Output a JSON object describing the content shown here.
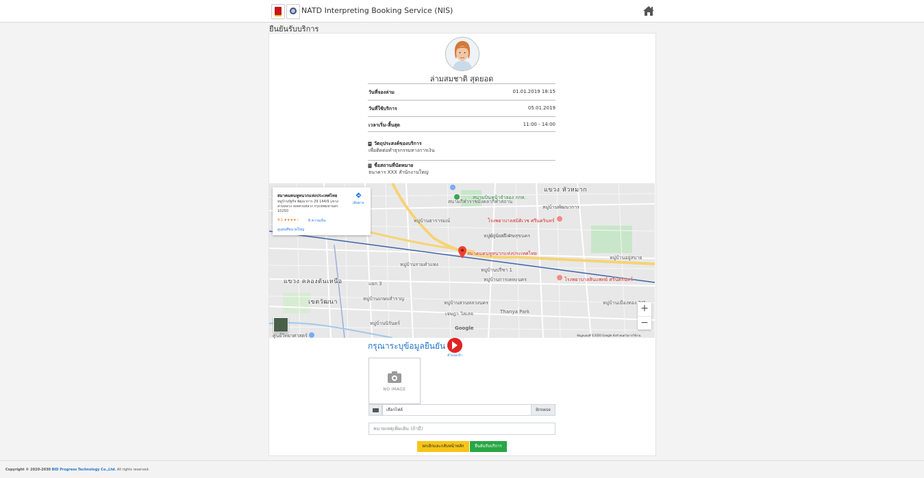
{
  "header": {
    "app_title": "NATD Interpreting Booking Service (NIS)"
  },
  "page": {
    "heading": "ยืนยันรับบริการ"
  },
  "profile": {
    "name": "ล่ามสมชาติ สุดยอด"
  },
  "details": [
    {
      "label": "วันที่จองล่าม",
      "value": "01.01.2019 18:15"
    },
    {
      "label": "วันที่ใช้บริการ",
      "value": "05.01.2019"
    },
    {
      "label": "เวลาเริ่ม-สิ้นสุด",
      "value": "11:00 - 14:00"
    }
  ],
  "purpose": {
    "title": "วัตถุประสงค์ของบริการ",
    "value": "เพื่อติดต่อทำธุรกรรมทางการเงิน"
  },
  "location": {
    "title": "ชื่อสถานที่นัดหมาย",
    "value": "ธนาคาร XXX สำนักงานใหญ่"
  },
  "map": {
    "place_name": "สมาคมคนหูหนวกแห่งประเทศไทย",
    "place_address": "หมู่บ้านรัฐกิจ พัฒนาการ 29 144/9 แขวงสวนหลวง เขตสวนหลวง กรุงเทพมหานคร 10250",
    "rating": "4.1 ★★★★☆",
    "reviews": "8 ความเห็น",
    "larger_map_link": "ดูแผนที่ขนาดใหญ่",
    "directions_label": "เส้นทาง",
    "attribution": "ข้อมูลแผนที่ ©2020 Google   ข้อกำหนดในการใช้งาน",
    "google_watermark": "Google",
    "zoom_in": "+",
    "zoom_out": "−",
    "labels": {
      "l1": "แขวง หัวหมาก",
      "l2": "สนามกีฬาราชมังคลากีฬาสถาน",
      "l3": "สนามบินหน้าจำลอง กกท.",
      "l4": "หมู่บ้านพัฒนาการ",
      "l5": "โรงพยาบาลสมิติเวช ศรีนครินทร์",
      "l6": "หมู่บ้านวิเศษสุขนคร",
      "l7": "สมาคมคนหูหนวกแห่งประเทศไทย",
      "l8": "แขวง คลองตันเหนือ",
      "l9": "เขตวัฒนา",
      "l10": "หมู่บ้านปรีชา 1",
      "l11": "หมู่บ้านการเคหะนคร",
      "l12": "โรงพยาบาลสินแพทย์ ศรีนครินทร์",
      "l13": "หมู่บ้านอยู่สบาย",
      "l14": "Thanya Park",
      "l15": "หมู่บ้านเมืองทอง 2/2",
      "l16": "ศูนย์วิทยาศาสตร์",
      "l17": "หมู่บ้านสวนหลวงนคร",
      "l18": "เจษฎา วิลเลจ",
      "l19": "หมู่บ้านนิรันดร์",
      "l20": "หมู่บ้านเสรี 4",
      "l21": "หมู่บ้านรามคำแหง",
      "l22": "แยก 3",
      "l23": "หมู่บ้านธารารมณ์",
      "l24": "หมู่บ้านเกษมสำราญ"
    }
  },
  "confirm": {
    "title": "กรุณาระบุข้อมูลยืนยัน",
    "video_label": "คำแนะนำ",
    "no_image": "NO IMAGE",
    "file_placeholder": "เลือกไฟล์",
    "browse": "Browse",
    "remark_placeholder": "หมายเหตุเพิ่มเติม (ถ้ามี)",
    "cancel_button": "ยกเลิกและกลับหน้าหลัก",
    "confirm_button": "ยืนยันรับบริการ"
  },
  "footer": {
    "copyright": "Copyright © 2020-2030",
    "company": "BID Progress Technology Co.,Ltd.",
    "rights": "All rights reserved."
  },
  "colors": {
    "accent": "#1e73c8",
    "cancel": "#f5c518",
    "confirm": "#28a745",
    "youtube": "#e02424"
  }
}
